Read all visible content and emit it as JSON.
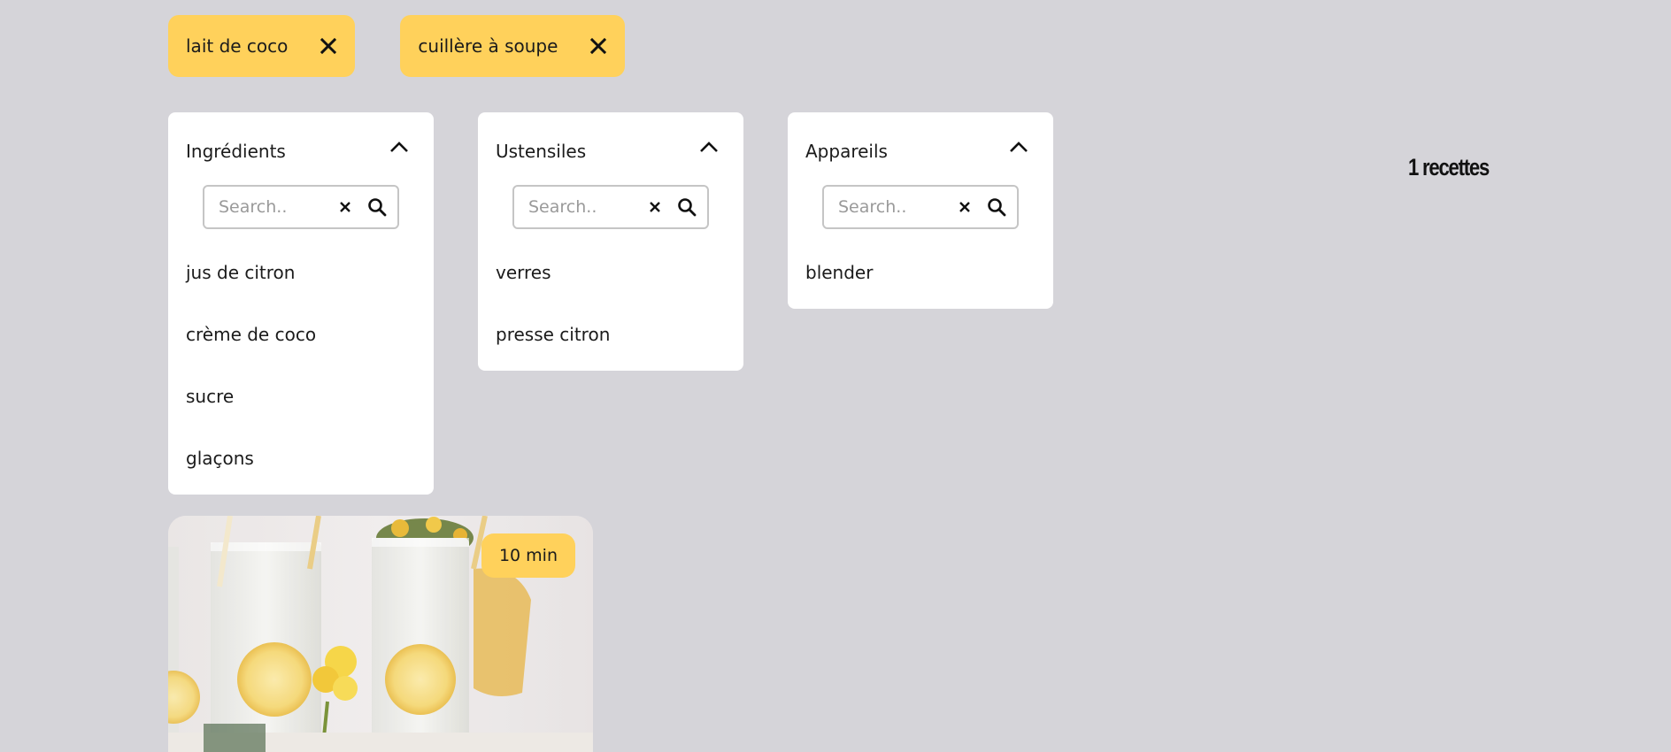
{
  "tags": [
    {
      "label": "lait de coco"
    },
    {
      "label": "cuillère à soupe"
    }
  ],
  "dropdowns": {
    "ingredients": {
      "title": "Ingrédients",
      "placeholder": "Search..",
      "items": [
        "jus de citron",
        "crème de coco",
        "sucre",
        "glaçons"
      ]
    },
    "ustensiles": {
      "title": "Ustensiles",
      "placeholder": "Search..",
      "items": [
        "verres",
        "presse citron"
      ]
    },
    "appareils": {
      "title": "Appareils",
      "placeholder": "Search..",
      "items": [
        "blender"
      ]
    }
  },
  "count": {
    "text": "1 recettes"
  },
  "recipe": {
    "time": "10 min"
  },
  "colors": {
    "background": "#d5d4d9",
    "accent": "#ffd15b",
    "panel": "#ffffff"
  },
  "icons": {
    "tag_remove": "close-icon",
    "dropdown_toggle": "chevron-up-icon",
    "search_clear": "clear-icon",
    "search": "search-icon"
  }
}
